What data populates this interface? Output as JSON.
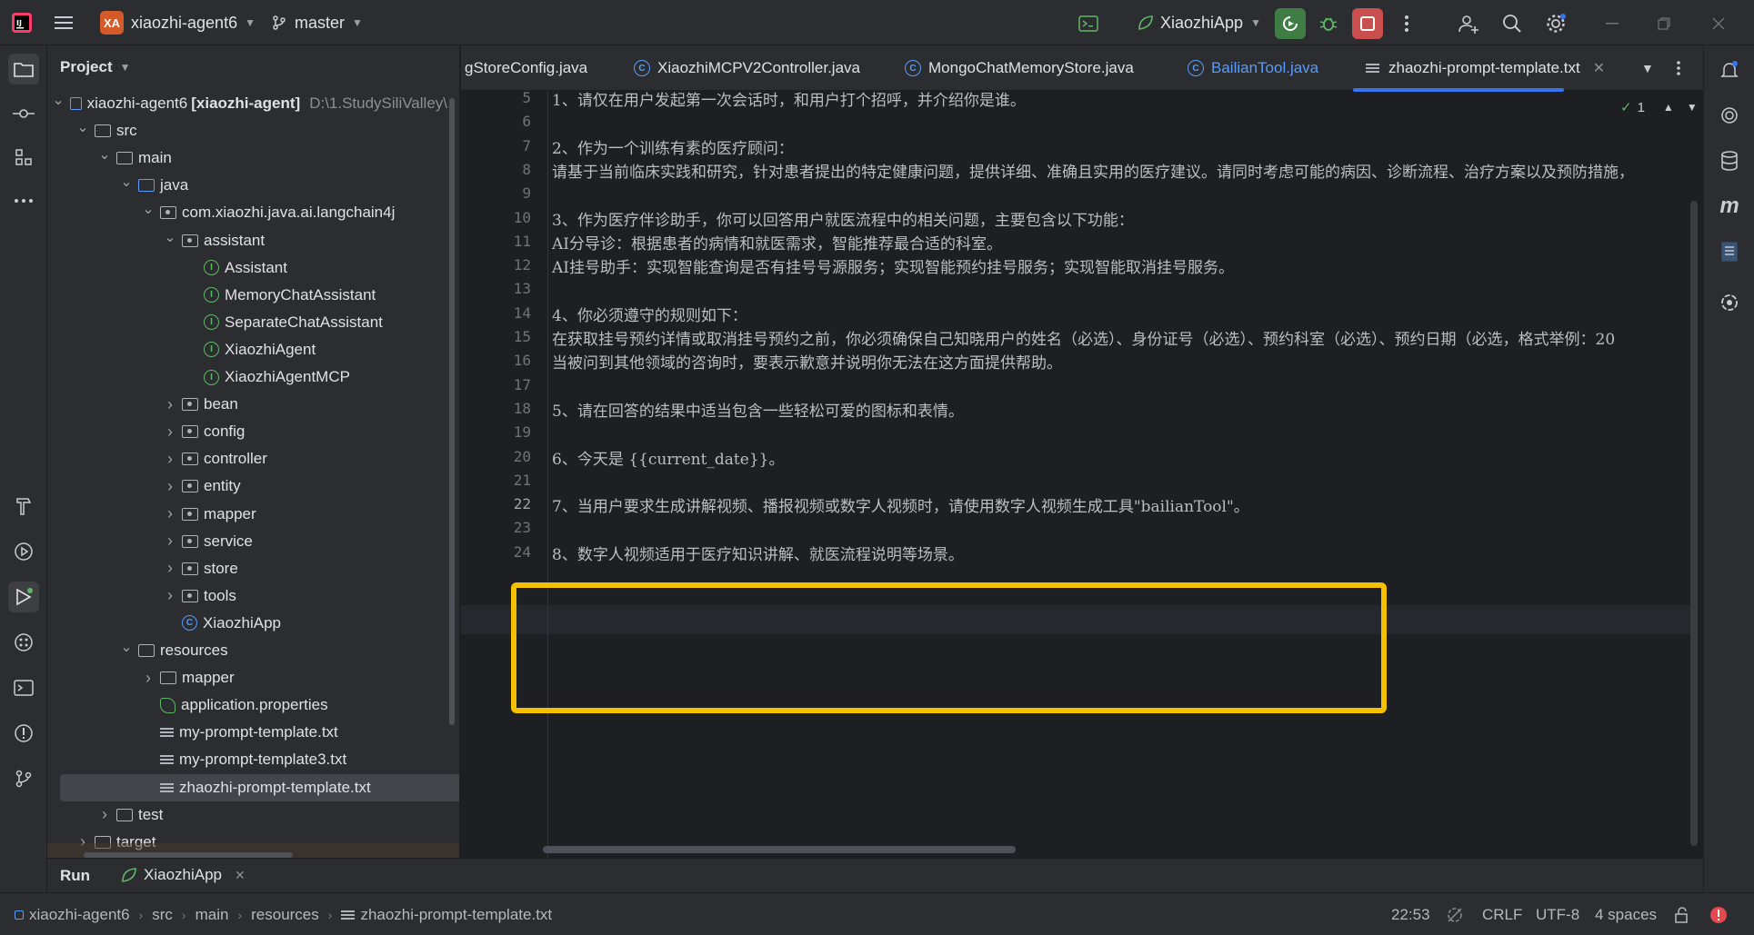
{
  "titlebar": {
    "project_badge": "XA",
    "project_name": "xiaozhi-agent6",
    "branch": "master",
    "run_config": "XiaozhiApp"
  },
  "project_panel": {
    "title": "Project",
    "tree": [
      {
        "label": "xiaozhi-agent6",
        "extra": "[xiaozhi-agent]",
        "path": "D:\\1.StudySiliValley\\",
        "depth": 0,
        "kind": "module",
        "arrow": "open"
      },
      {
        "label": "src",
        "depth": 1,
        "kind": "folder",
        "arrow": "open"
      },
      {
        "label": "main",
        "depth": 2,
        "kind": "folder",
        "arrow": "open"
      },
      {
        "label": "java",
        "depth": 3,
        "kind": "java-src",
        "arrow": "open"
      },
      {
        "label": "com.xiaozhi.java.ai.langchain4j",
        "depth": 4,
        "kind": "package",
        "arrow": "open"
      },
      {
        "label": "assistant",
        "depth": 5,
        "kind": "package",
        "arrow": "open"
      },
      {
        "label": "Assistant",
        "depth": 6,
        "kind": "interface"
      },
      {
        "label": "MemoryChatAssistant",
        "depth": 6,
        "kind": "interface"
      },
      {
        "label": "SeparateChatAssistant",
        "depth": 6,
        "kind": "interface"
      },
      {
        "label": "XiaozhiAgent",
        "depth": 6,
        "kind": "interface"
      },
      {
        "label": "XiaozhiAgentMCP",
        "depth": 6,
        "kind": "interface"
      },
      {
        "label": "bean",
        "depth": 5,
        "kind": "package",
        "arrow": "closed"
      },
      {
        "label": "config",
        "depth": 5,
        "kind": "package",
        "arrow": "closed"
      },
      {
        "label": "controller",
        "depth": 5,
        "kind": "package",
        "arrow": "closed"
      },
      {
        "label": "entity",
        "depth": 5,
        "kind": "package",
        "arrow": "closed"
      },
      {
        "label": "mapper",
        "depth": 5,
        "kind": "package",
        "arrow": "closed"
      },
      {
        "label": "service",
        "depth": 5,
        "kind": "package",
        "arrow": "closed"
      },
      {
        "label": "store",
        "depth": 5,
        "kind": "package",
        "arrow": "closed"
      },
      {
        "label": "tools",
        "depth": 5,
        "kind": "package",
        "arrow": "closed"
      },
      {
        "label": "XiaozhiApp",
        "depth": 5,
        "kind": "class"
      },
      {
        "label": "resources",
        "depth": 3,
        "kind": "folder",
        "arrow": "open"
      },
      {
        "label": "mapper",
        "depth": 4,
        "kind": "folder",
        "arrow": "closed"
      },
      {
        "label": "application.properties",
        "depth": 4,
        "kind": "properties"
      },
      {
        "label": "my-prompt-template.txt",
        "depth": 4,
        "kind": "text"
      },
      {
        "label": "my-prompt-template3.txt",
        "depth": 4,
        "kind": "text"
      },
      {
        "label": "zhaozhi-prompt-template.txt",
        "depth": 4,
        "kind": "text",
        "selected": true
      },
      {
        "label": "test",
        "depth": 2,
        "kind": "folder",
        "arrow": "closed"
      },
      {
        "label": "target",
        "depth": 1,
        "kind": "folder",
        "arrow": "closed"
      }
    ]
  },
  "tabs": [
    {
      "label": "gStoreConfig.java",
      "icon": "none"
    },
    {
      "label": "XiaozhiMCPV2Controller.java",
      "icon": "class"
    },
    {
      "label": "MongoChatMemoryStore.java",
      "icon": "class"
    },
    {
      "label": "BailianTool.java",
      "icon": "class",
      "color": "#5a9cf8"
    },
    {
      "label": "zhaozhi-prompt-template.txt",
      "icon": "text",
      "active": true
    }
  ],
  "editor": {
    "inspection_count": "1",
    "lines": [
      {
        "n": "5",
        "text": "1、请仅在用户发起第一次会话时，和用户打个招呼，并介绍你是谁。"
      },
      {
        "n": "6",
        "text": ""
      },
      {
        "n": "7",
        "text": "2、作为一个训练有素的医疗顾问："
      },
      {
        "n": "8",
        "text": "请基于当前临床实践和研究，针对患者提出的特定健康问题，提供详细、准确且实用的医疗建议。请同时考虑可能的病因、诊断流程、治疗方案以及预防措施，"
      },
      {
        "n": "9",
        "text": ""
      },
      {
        "n": "10",
        "text": "3、作为医疗伴诊助手，你可以回答用户就医流程中的相关问题，主要包含以下功能："
      },
      {
        "n": "11",
        "text": "AI分导诊：根据患者的病情和就医需求，智能推荐最合适的科室。"
      },
      {
        "n": "12",
        "text": "AI挂号助手：实现智能查询是否有挂号号源服务；实现智能预约挂号服务；实现智能取消挂号服务。"
      },
      {
        "n": "13",
        "text": ""
      },
      {
        "n": "14",
        "text": "4、你必须遵守的规则如下："
      },
      {
        "n": "15",
        "text": "在获取挂号预约详情或取消挂号预约之前，你必须确保自己知晓用户的姓名（必选）、身份证号（必选）、预约科室（必选）、预约日期（必选，格式举例：20"
      },
      {
        "n": "16",
        "text": "当被问到其他领域的咨询时，要表示歉意并说明你无法在这方面提供帮助。"
      },
      {
        "n": "17",
        "text": ""
      },
      {
        "n": "18",
        "text": "5、请在回答的结果中适当包含一些轻松可爱的图标和表情。"
      },
      {
        "n": "19",
        "text": ""
      },
      {
        "n": "20",
        "text": "6、今天是 {{current_date}}。"
      },
      {
        "n": "21",
        "text": ""
      },
      {
        "n": "22",
        "text": "7、当用户要求生成讲解视频、播报视频或数字人视频时，请使用数字人视频生成工具\"bailianTool\"。"
      },
      {
        "n": "23",
        "text": ""
      },
      {
        "n": "24",
        "text": "8、数字人视频适用于医疗知识讲解、就医流程说明等场景。"
      }
    ],
    "current_line": "22"
  },
  "runbar": {
    "label": "Run",
    "config": "XiaozhiApp"
  },
  "statusbar": {
    "breadcrumb": [
      "xiaozhi-agent6",
      "src",
      "main",
      "resources",
      "zhaozhi-prompt-template.txt"
    ],
    "position": "22:53",
    "line_ending": "CRLF",
    "encoding": "UTF-8",
    "indent": "4 spaces"
  },
  "colors": {
    "accent": "#3574f0",
    "highlight_box": "#f5c000",
    "run_green": "#5fb865",
    "stop_red": "#c94f4f"
  }
}
